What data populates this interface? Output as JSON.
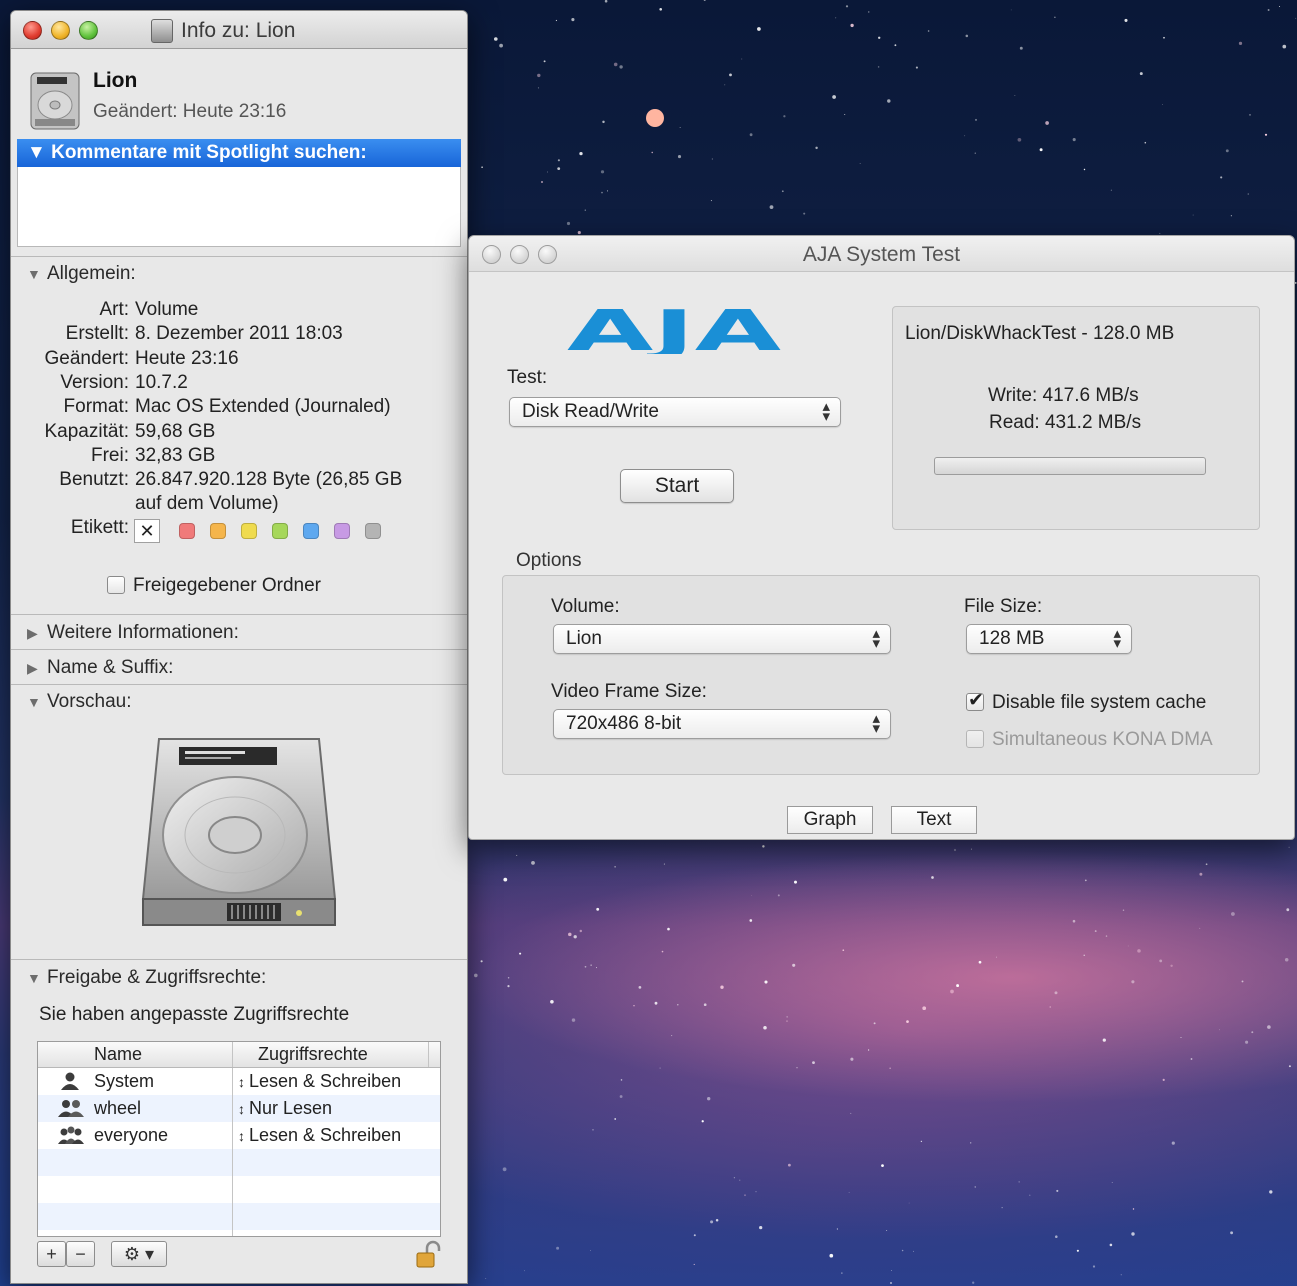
{
  "info_window": {
    "title": "Info zu: Lion",
    "volume_name": "Lion",
    "changed_summary": "Geändert:  Heute 23:16",
    "spotlight_header": "Kommentare mit Spotlight suchen:",
    "general": {
      "header": "Allgemein:",
      "rows": [
        {
          "key": "Art:",
          "value": "Volume"
        },
        {
          "key": "Erstellt:",
          "value": "8. Dezember 2011 18:03"
        },
        {
          "key": "Geändert:",
          "value": "Heute 23:16"
        },
        {
          "key": "Version:",
          "value": "10.7.2"
        },
        {
          "key": "Format:",
          "value": "Mac OS Extended (Journaled)"
        },
        {
          "key": "Kapazität:",
          "value": "59,68 GB"
        },
        {
          "key": "Frei:",
          "value": "32,83 GB"
        },
        {
          "key": "Benutzt:",
          "value": "26.847.920.128 Byte (26,85 GB"
        },
        {
          "key": "",
          "value": "auf dem Volume)"
        }
      ],
      "label_key": "Etikett:",
      "label_clear": "✕",
      "label_colors": [
        "#f07a7a",
        "#f5b54b",
        "#efdb4e",
        "#a6d75a",
        "#5ea8ef",
        "#c79ae4",
        "#b4b4b4"
      ],
      "shared_folder": "Freigegebener Ordner"
    },
    "sections": {
      "more_info": "Weitere Informationen:",
      "name_suffix": "Name & Suffix:",
      "preview": "Vorschau:",
      "sharing": "Freigabe & Zugriffsrechte:"
    },
    "sharing": {
      "note": "Sie haben angepasste Zugriffsrechte",
      "col_name": "Name",
      "col_rights": "Zugriffsrechte",
      "rows": [
        {
          "name": "System",
          "rights": "Lesen & Schreiben",
          "icon": "single-user-icon"
        },
        {
          "name": "wheel",
          "rights": "Nur Lesen",
          "icon": "group-icon"
        },
        {
          "name": "everyone",
          "rights": "Lesen & Schreiben",
          "icon": "everyone-icon"
        }
      ],
      "add_label": "+",
      "remove_label": "−",
      "gear_label": "⚙ ▾"
    }
  },
  "aja_window": {
    "title": "AJA System Test",
    "logo_text": "AJA",
    "test_label": "Test:",
    "test_value": "Disk Read/Write",
    "start_label": "Start",
    "result": {
      "file_line": "Lion/DiskWhackTest - 128.0 MB",
      "write": "Write: 417.6 MB/s",
      "read": "Read: 431.2 MB/s",
      "progress_fraction": 0
    },
    "options": {
      "header": "Options",
      "volume_label": "Volume:",
      "volume_value": "Lion",
      "file_size_label": "File Size:",
      "file_size_value": "128 MB",
      "frame_label": "Video Frame Size:",
      "frame_value": "720x486 8-bit",
      "disable_cache": "Disable file system cache",
      "disable_cache_checked": true,
      "kona_dma": "Simultaneous KONA DMA",
      "kona_dma_checked": false
    },
    "graph_label": "Graph",
    "text_label": "Text",
    "brand_color": "#1a8fd6"
  }
}
